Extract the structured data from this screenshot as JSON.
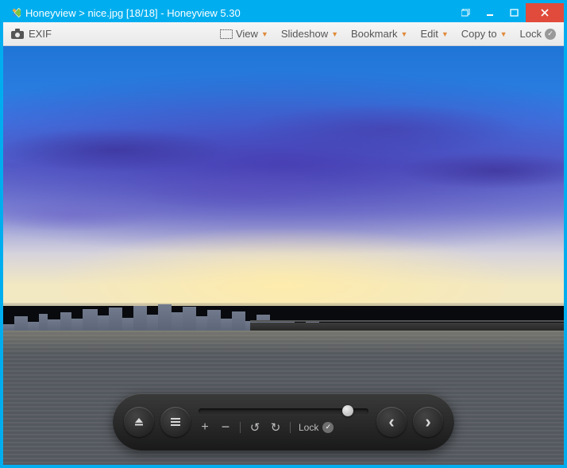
{
  "titlebar": {
    "app_name": "Honeyview",
    "separator": ">",
    "file_name": "nice.jpg",
    "index": "[18/18]",
    "dash": "-",
    "app_version": "Honeyview 5.30"
  },
  "toolbar": {
    "exif_label": "EXIF",
    "view_label": "View",
    "slideshow_label": "Slideshow",
    "bookmark_label": "Bookmark",
    "edit_label": "Edit",
    "copyto_label": "Copy to",
    "lock_label": "Lock",
    "lock_check": "✓"
  },
  "overlay": {
    "lock_label": "Lock",
    "lock_check": "✓",
    "slider_position_percent": 88
  },
  "icons": {
    "camera": "camera-icon",
    "dropdown": "▼",
    "eject": "eject-icon",
    "menu": "menu-icon",
    "plus": "+",
    "minus": "−",
    "undo": "↺",
    "redo": "↻",
    "prev": "‹",
    "next": "›"
  }
}
